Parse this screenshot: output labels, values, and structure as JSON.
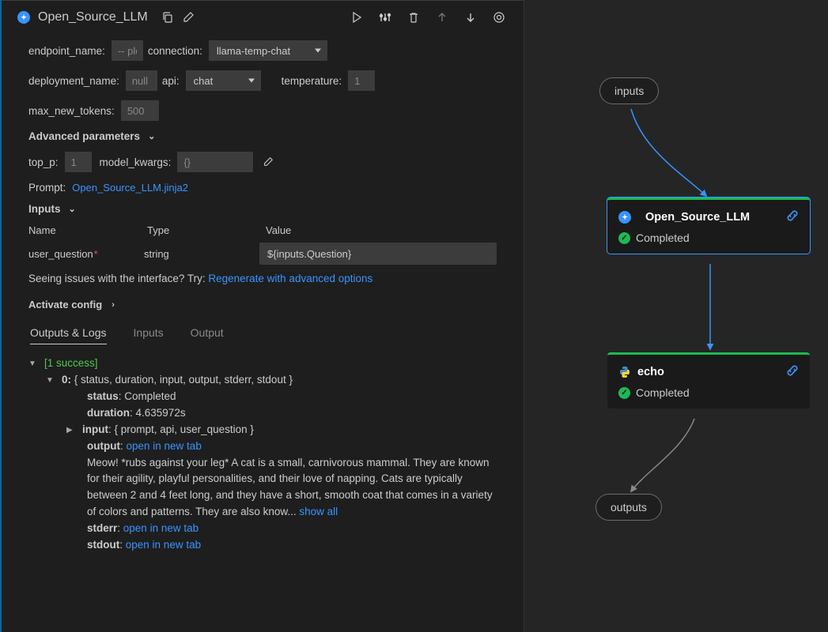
{
  "header": {
    "title": "Open_Source_LLM"
  },
  "form": {
    "endpoint_name_label": "endpoint_name:",
    "endpoint_name_placeholder": "-- ple",
    "connection_label": "connection:",
    "connection_value": "llama-temp-chat",
    "deployment_name_label": "deployment_name:",
    "deployment_name_placeholder": "null",
    "api_label": "api:",
    "api_value": "chat",
    "temperature_label": "temperature:",
    "temperature_value": "1",
    "max_new_tokens_label": "max_new_tokens:",
    "max_new_tokens_value": "500",
    "advanced_label": "Advanced parameters",
    "top_p_label": "top_p:",
    "top_p_value": "1",
    "model_kwargs_label": "model_kwargs:",
    "model_kwargs_placeholder": "{}"
  },
  "prompt": {
    "label": "Prompt:",
    "file": "Open_Source_LLM.jinja2"
  },
  "inputs": {
    "section_label": "Inputs",
    "col_name": "Name",
    "col_type": "Type",
    "col_value": "Value",
    "rows": [
      {
        "name": "user_question",
        "required": "*",
        "type": "string",
        "value": "${inputs.Question}"
      }
    ],
    "hint_prefix": "Seeing issues with the interface? Try: ",
    "hint_link": "Regenerate with advanced options"
  },
  "activate_label": "Activate config",
  "tabs": {
    "outputs_logs": "Outputs & Logs",
    "inputs": "Inputs",
    "output": "Output"
  },
  "logs": {
    "success_count": "1 success",
    "item_prefix": "0:",
    "item_summary": "{ status, duration, input, output, stderr, stdout }",
    "status_key": "status",
    "status_val": "Completed",
    "duration_key": "duration",
    "duration_val": "4.635972s",
    "input_key": "input",
    "input_summary": "{ prompt, api, user_question }",
    "output_key": "output",
    "open_tab": "open in new tab",
    "output_text": "Meow! *rubs against your leg* A cat is a small, carnivorous mammal. They are known for their agility, playful personalities, and their love of napping. Cats are typically between 2 and 4 feet long, and they have a short, smooth coat that comes in a variety of colors and patterns. They are also know... ",
    "show_all": "show all",
    "stderr_key": "stderr",
    "stdout_key": "stdout"
  },
  "graph": {
    "inputs_label": "inputs",
    "outputs_label": "outputs",
    "nodes": [
      {
        "name": "Open_Source_LLM",
        "status": "Completed"
      },
      {
        "name": "echo",
        "status": "Completed"
      }
    ]
  }
}
